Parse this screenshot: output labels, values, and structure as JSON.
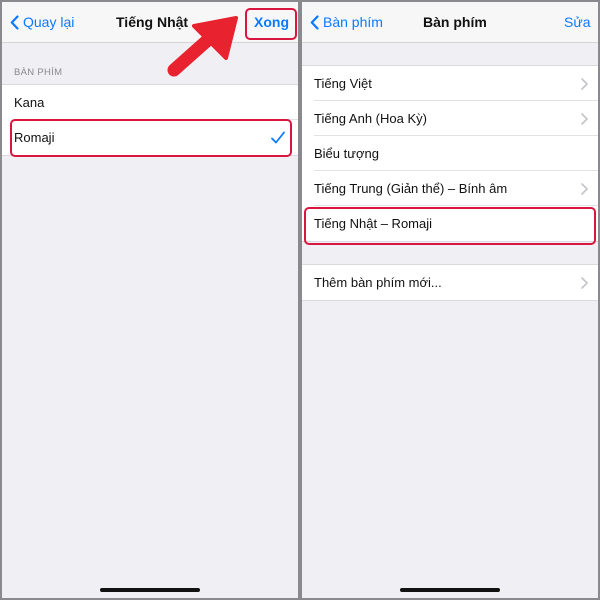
{
  "left": {
    "back_label": "Quay lại",
    "title": "Tiếng Nhật",
    "done_label": "Xong",
    "section_header": "BÀN PHÍM",
    "rows": [
      {
        "label": "Kana",
        "selected": false
      },
      {
        "label": "Romaji",
        "selected": true
      }
    ]
  },
  "right": {
    "back_label": "Bàn phím",
    "title": "Bàn phím",
    "edit_label": "Sửa",
    "keyboards": [
      {
        "label": "Tiếng Việt",
        "chevron": true
      },
      {
        "label": "Tiếng Anh (Hoa Kỳ)",
        "chevron": true
      },
      {
        "label": "Biểu tượng",
        "chevron": false
      },
      {
        "label": "Tiếng Trung (Giản thể) – Bính âm",
        "chevron": true
      },
      {
        "label": "Tiếng Nhật – Romaji",
        "chevron": false
      }
    ],
    "add_keyboard_label": "Thêm bàn phím mới..."
  },
  "colors": {
    "accent": "#0a7aff",
    "highlight": "#d8163f",
    "annotation_arrow": "#e8222e",
    "background": "#efeff4"
  },
  "icons": {
    "back": "chevron-left-icon",
    "disclosure": "chevron-right-icon",
    "selected": "checkmark-icon",
    "annotation": "red-arrow-icon"
  }
}
